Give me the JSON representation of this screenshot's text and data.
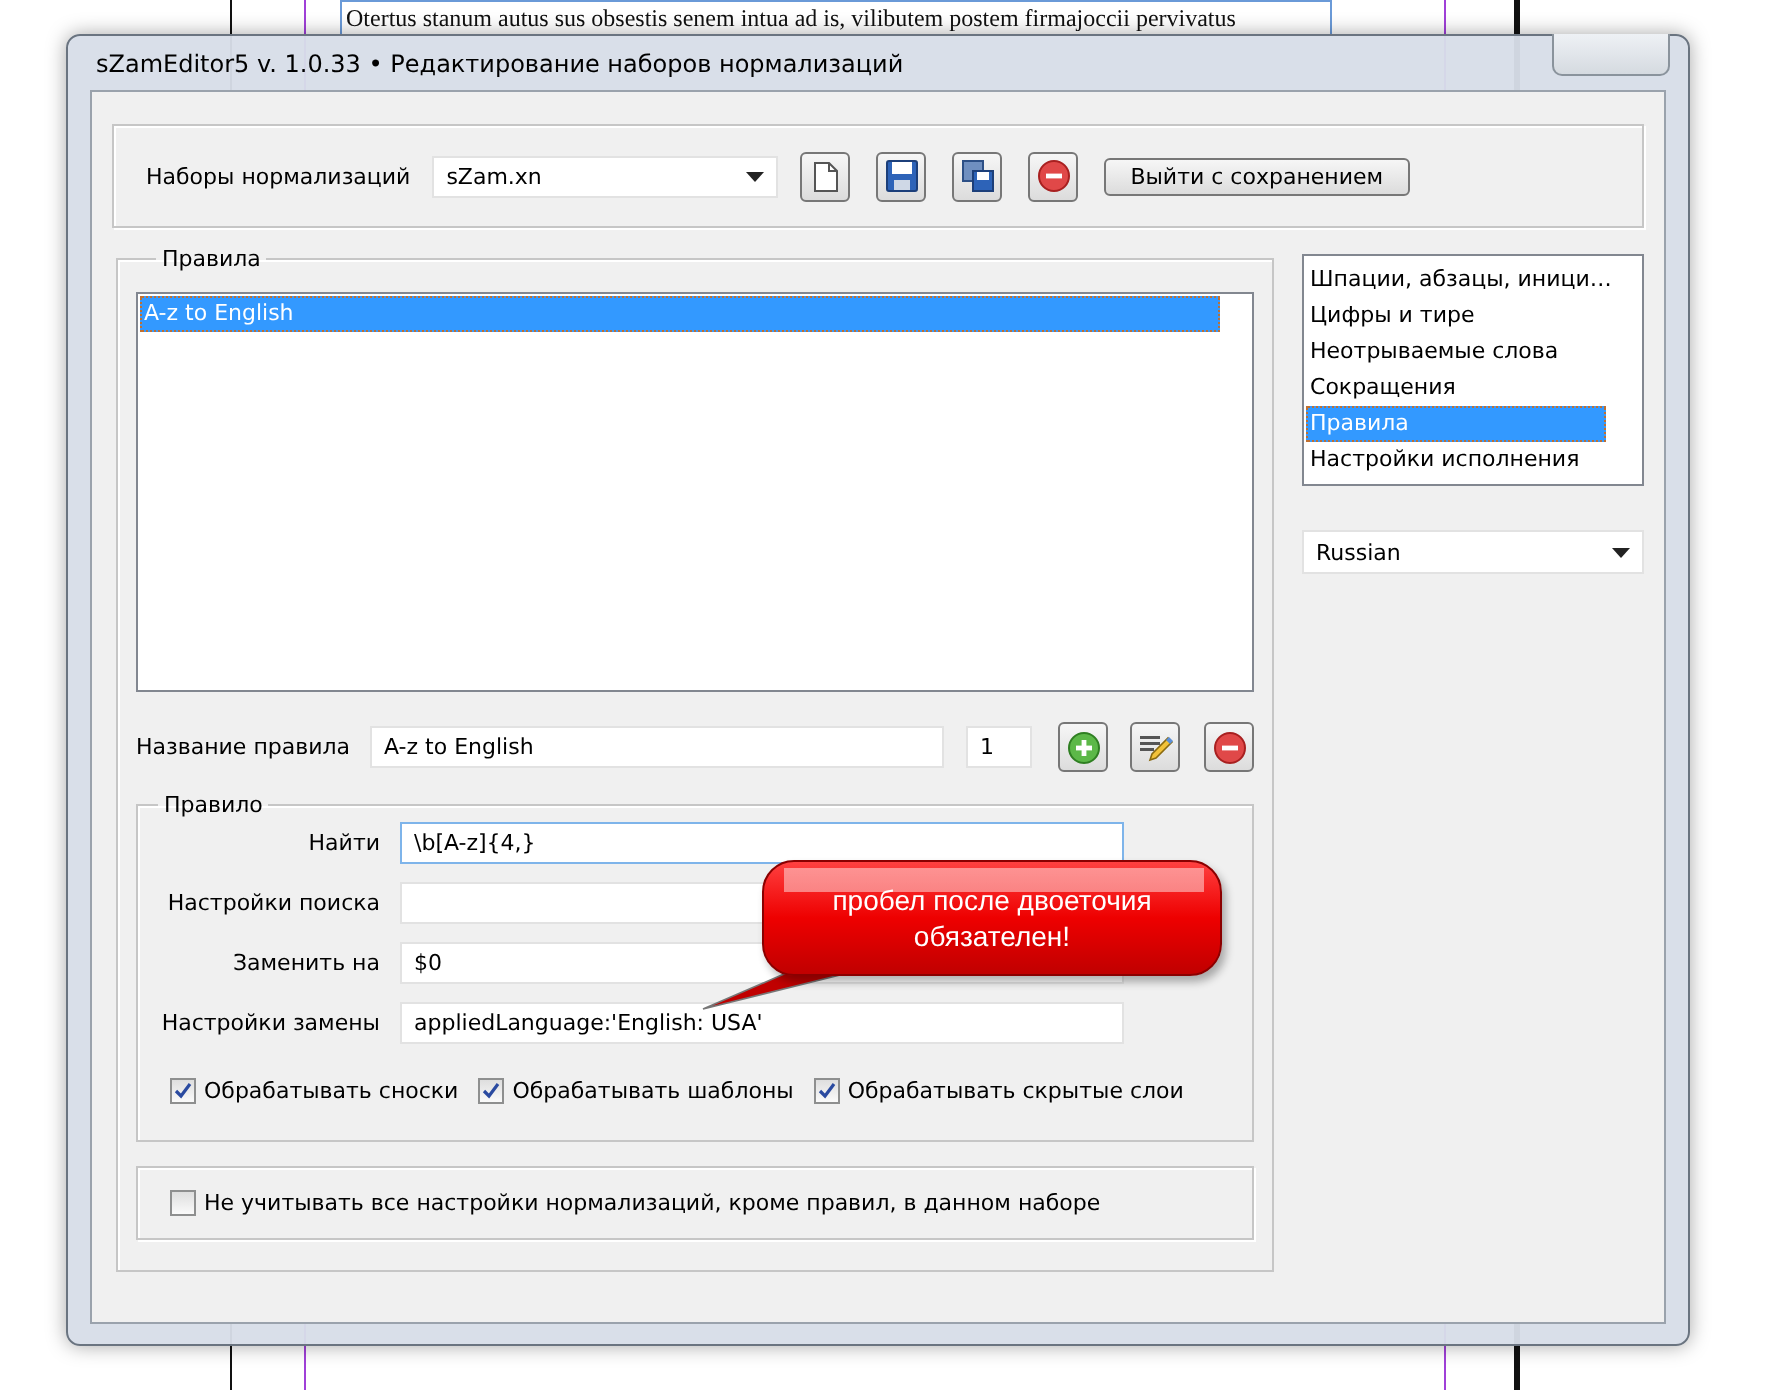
{
  "background_document": {
    "text": "Otertus stanum autus sus obsestis senem intua ad is, vilibutem postem firmajoccii pervivatus"
  },
  "window": {
    "title": "sZamEditor5 v. 1.0.33 • Редактирование наборов нормализаций"
  },
  "sets_bar": {
    "label": "Наборы нормализаций",
    "value": "sZam.xn",
    "exit_button": "Выйти с сохранением"
  },
  "rules_group": {
    "title": "Правила",
    "rules": [
      {
        "label": "A-z to English",
        "selected": true
      }
    ]
  },
  "rule_name": {
    "label": "Название правила",
    "value": "A-z to English",
    "number": "1"
  },
  "rule_group": {
    "title": "Правило",
    "fields": [
      {
        "label": "Найти",
        "value": "\\b[A-z]{4,}",
        "focused": true
      },
      {
        "label": "Настройки поиска",
        "focused": false
      },
      {
        "label": "Заменить на",
        "value": "$0",
        "focused": false
      },
      {
        "label": "Настройки замены",
        "value": "appliedLanguage:'English: USA'",
        "focused": false
      }
    ],
    "options": [
      {
        "label": "Обрабатывать сноски",
        "checked": true
      },
      {
        "label": "Обрабатывать шаблоны",
        "checked": true
      },
      {
        "label": "Обрабатывать скрытые слои",
        "checked": true
      }
    ]
  },
  "ignore_option": {
    "label": "Не учитывать все настройки нормализаций, кроме правил, в данном наборе",
    "checked": false
  },
  "sections": [
    {
      "label": "Шпации, абзацы, иници…",
      "selected": false
    },
    {
      "label": "Цифры и тире",
      "selected": false
    },
    {
      "label": "Неотрываемые слова",
      "selected": false
    },
    {
      "label": "Сокращения",
      "selected": false
    },
    {
      "label": "Правила",
      "selected": true
    },
    {
      "label": "Настройки исполнения",
      "selected": false
    }
  ],
  "language": {
    "value": "Russian"
  },
  "callout": {
    "text": "пробел после двоеточия обязателен!"
  }
}
